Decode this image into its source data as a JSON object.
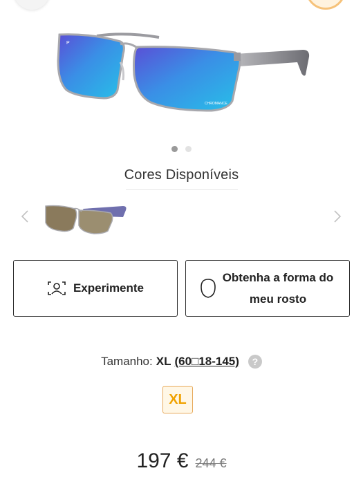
{
  "header": {
    "left_icon": "back-circle-icon",
    "right_icon": "profile-circle-icon"
  },
  "product": {
    "hero_image_icon": "sunglasses-icon",
    "lens_brand_text": "CHROMANCE",
    "polarized_mark": "P",
    "gallery": {
      "total": 2,
      "active_index": 0
    }
  },
  "colors": {
    "title": "Cores Disponíveis",
    "swatch_icon": "sunglasses-swatch-icon"
  },
  "actions": {
    "try_on_label": "Experimente",
    "try_on_icon": "face-scan-icon",
    "face_shape_label": "Obtenha a forma do meu rosto",
    "face_shape_icon": "face-outline-icon"
  },
  "size": {
    "label": "Tamanho:",
    "value": "XL",
    "dimensions": "(60□18-145)",
    "help_icon": "question-icon",
    "help_glyph": "?",
    "options": [
      "XL"
    ]
  },
  "price": {
    "current": "197 €",
    "original": "244 €"
  },
  "colors_accent": {
    "size_chip": "#f0a200",
    "lens": "#2a9be0"
  }
}
